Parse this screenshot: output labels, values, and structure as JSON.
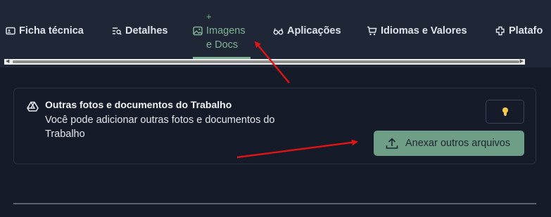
{
  "tabs": {
    "ficha": "Ficha técnica",
    "detalhes": "Detalhes",
    "imagens_plus": "+",
    "imagens_line1": "Imagens",
    "imagens_line2": "e Docs",
    "aplicacoes": "Aplicações",
    "idiomas": "Idiomas e Valores",
    "plataformas": "Platafo"
  },
  "card": {
    "title": "Outras fotos e documentos do Trabalho",
    "description": "Você pode adicionar outras fotos e documentos do Trabalho",
    "attach_label": "Anexar outros arquivos"
  },
  "colors": {
    "background": "#151b29",
    "topbar": "#1f2737",
    "accent": "#7fb394",
    "button": "#6f9e87",
    "arrow": "#e01414"
  },
  "icons": [
    "info-card-icon",
    "list-search-icon",
    "image-icon",
    "glasses-icon",
    "cart-icon",
    "puzzle-icon",
    "drive-icon",
    "lightbulb-icon",
    "upload-icon"
  ]
}
